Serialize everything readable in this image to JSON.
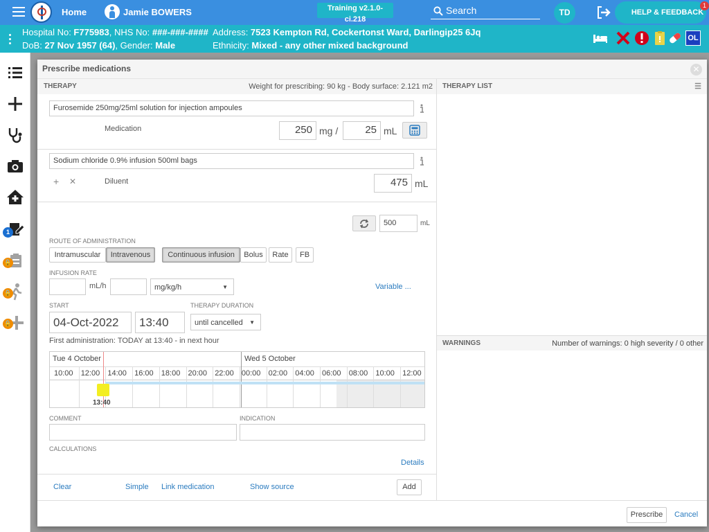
{
  "topbar": {
    "home_label": "Home",
    "patient_name": "Jamie BOWERS",
    "training_badge": "Training v2.1.0-ci.218",
    "search_label": "Search",
    "user_initials": "TD",
    "help_label": "HELP & FEEDBACK",
    "help_badge_count": "1"
  },
  "patient_banner": {
    "hospital_label": "Hospital No: ",
    "hospital_no": "F775983",
    "nhs_label": ", NHS No: ",
    "nhs_no": "###-###-####",
    "address_label": "Address: ",
    "address": "7523 Kempton Rd, Cockertonst Ward, Darlingip25 6Jq",
    "dob_label": "DoB: ",
    "dob": "27 Nov 1957 (64)",
    "gender_label": ", Gender: ",
    "gender": "Male",
    "ethnicity_label": "Ethnicity: ",
    "ethnicity": "Mixed - any other mixed background",
    "ol_badge": "OL"
  },
  "sidebar": {
    "draft_badge": "1"
  },
  "modal": {
    "title": "Prescribe medications",
    "therapy": {
      "header": "THERAPY",
      "weight_info": "Weight for prescribing: 90 kg - Body surface: 2.121 m2",
      "medication_name": "Furosemide 250mg/25ml solution for injection ampoules",
      "medication_label": "Medication",
      "dose_mg": "250",
      "dose_unit": "mg /",
      "volume_ml": "25",
      "volume_unit": "mL",
      "diluent_name": "Sodium chloride 0.9% infusion 500ml bags",
      "diluent_label": "Diluent",
      "diluent_volume": "475",
      "diluent_unit": "mL",
      "total_volume": "500",
      "total_unit": "mL",
      "add_symbol": "+",
      "remove_symbol": "✕",
      "route_label": "ROUTE OF ADMINISTRATION",
      "routes": [
        "Intramuscular",
        "Intravenous"
      ],
      "selected_route": "Intravenous",
      "modes": [
        "Continuous infusion",
        "Bolus",
        "Rate",
        "FB"
      ],
      "selected_mode": "Continuous infusion",
      "infusion_rate_label": "INFUSION RATE",
      "rate_unit": "mL/h",
      "dose_rate_unit": "mg/kg/h",
      "variable_link": "Variable ...",
      "start_label": "START",
      "start_date": "04-Oct-2022",
      "start_time": "13:40",
      "duration_label": "THERAPY DURATION",
      "duration_value": "until cancelled",
      "first_admin": "First administration: TODAY at 13:40 - in next hour",
      "timeline": {
        "day1": "Tue 4 October",
        "day2": "Wed 5 October",
        "hours": [
          "10:00",
          "12:00",
          "14:00",
          "16:00",
          "18:00",
          "20:00",
          "22:00",
          "00:00",
          "02:00",
          "04:00",
          "06:00",
          "08:00",
          "10:00",
          "12:00"
        ],
        "marker_label": "13:40"
      },
      "comment_label": "COMMENT",
      "indication_label": "INDICATION",
      "calculations_label": "CALCULATIONS",
      "details_link": "Details",
      "footer_links": {
        "clear": "Clear",
        "simple": "Simple",
        "link_medication": "Link medication",
        "show_source": "Show source"
      },
      "add_button": "Add"
    },
    "therapy_list": {
      "header": "THERAPY LIST"
    },
    "warnings": {
      "header": "WARNINGS",
      "summary": "Number of warnings: 0 high severity / 0 other"
    },
    "prescribe_button": "Prescribe",
    "cancel_link": "Cancel"
  },
  "colors": {
    "topbar": "#3a8fe0",
    "banner": "#1fb5c8",
    "link": "#2a7bbf",
    "marker": "#f3ee22"
  }
}
